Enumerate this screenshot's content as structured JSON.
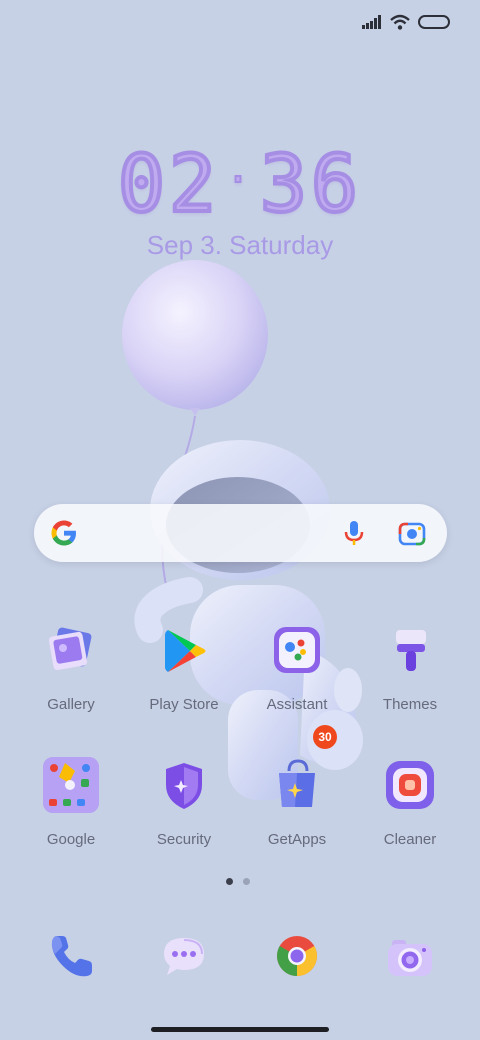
{
  "status_bar": {
    "icons": [
      "signal-icon",
      "wifi-icon",
      "battery-icon"
    ]
  },
  "lockscreen": {
    "clock_hours": "02",
    "clock_minutes": "36",
    "date": "Sep 3. Saturday"
  },
  "search": {
    "icons": [
      "google-g-icon",
      "microphone-icon",
      "camera-lens-icon"
    ]
  },
  "apps": [
    {
      "label": "Gallery",
      "icon": "gallery-icon"
    },
    {
      "label": "Play Store",
      "icon": "play-store-icon"
    },
    {
      "label": "Assistant",
      "icon": "assistant-icon"
    },
    {
      "label": "Themes",
      "icon": "themes-icon"
    },
    {
      "label": "Google",
      "icon": "google-folder-icon"
    },
    {
      "label": "Security",
      "icon": "security-icon"
    },
    {
      "label": "GetApps",
      "icon": "getapps-icon",
      "badge": "30"
    },
    {
      "label": "Cleaner",
      "icon": "cleaner-icon"
    }
  ],
  "dock": [
    {
      "icon": "phone-icon"
    },
    {
      "icon": "messages-icon"
    },
    {
      "icon": "chrome-icon"
    },
    {
      "icon": "camera-icon"
    }
  ],
  "pager": {
    "pages": 2,
    "current": 1
  },
  "colors": {
    "background": "#c7d1e6",
    "clock": "#a58ee4",
    "badge": "#f0481d"
  }
}
